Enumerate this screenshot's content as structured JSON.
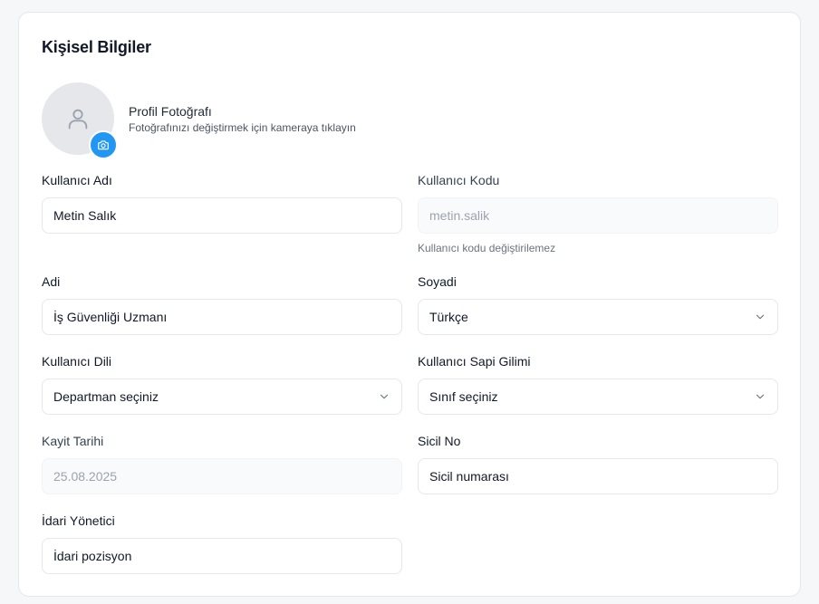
{
  "section": {
    "title": "Kişisel Bilgiler"
  },
  "profile_photo": {
    "title": "Profil Fotoğrafı",
    "description": "Fotoğrafınızı değiştirmek için kameraya tıklayın",
    "avatar_icon": "user-icon",
    "camera_icon": "camera-icon",
    "camera_color": "#2196f3"
  },
  "fields": {
    "kullanici_adi": {
      "label": "Kullanıcı Adı",
      "value": "Metin Salık"
    },
    "kullanici_kodu": {
      "label": "Kullanıcı Kodu",
      "value": "metin.salik",
      "hint": "Kullanıcı kodu değiştirilemez",
      "disabled": true
    },
    "adi": {
      "label": "Adi",
      "value": "İş Güvenliği Uzmanı"
    },
    "soyadi": {
      "label": "Soyadi",
      "value": "Türkçe"
    },
    "kullanici_dili": {
      "label": "Kullanıcı Dili",
      "value": "Departman seçiniz"
    },
    "kullanici_sapi_gilimi": {
      "label": "Kullanıcı Sapi Gilimi",
      "value": "Sınıf seçiniz"
    },
    "kayit_tarihi": {
      "label": "Kayit Tarihi",
      "value": "25.08.2025",
      "disabled": true
    },
    "sicil_no": {
      "label": "Sicil No",
      "value": "Sicil numarası"
    },
    "idari_yonetici": {
      "label": "İdari Yönetici",
      "value": "İdari pozisyon"
    }
  }
}
